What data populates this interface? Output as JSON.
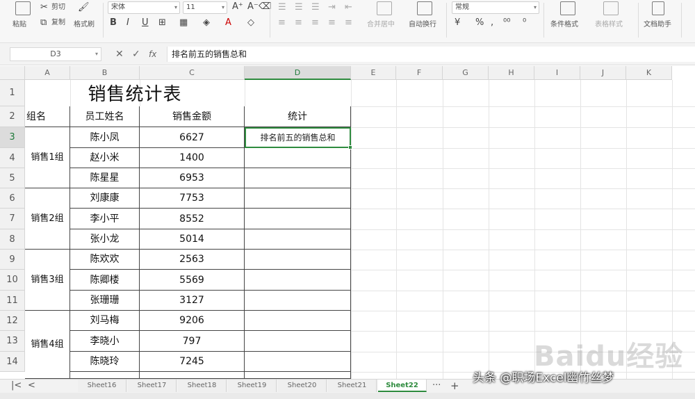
{
  "ribbon": {
    "clipboard": {
      "cut": "剪切",
      "paste": "粘贴",
      "copy": "复制",
      "format_painter": "格式刷"
    },
    "font_name": "宋体",
    "font_size": "11",
    "number_format": "常规",
    "buttons": {
      "wrap_text": "合并居中",
      "auto_wrap": "自动换行",
      "conditional_format": "条件格式",
      "table_style": "表格样式",
      "doc_assistant": "文档助手"
    }
  },
  "formula_bar": {
    "name_box": "D3",
    "fx": "fx",
    "content": "排名前五的销售总和"
  },
  "columns": [
    "A",
    "B",
    "C",
    "D",
    "E",
    "F",
    "G",
    "H",
    "I",
    "J",
    "K"
  ],
  "rows": [
    "1",
    "2",
    "3",
    "4",
    "5",
    "6",
    "7",
    "8",
    "9",
    "10",
    "11",
    "12",
    "13",
    "14"
  ],
  "sheet": {
    "title": "销售统计表",
    "headers": {
      "group": "组名",
      "name": "员工姓名",
      "amount": "销售金额",
      "stat": "统计"
    },
    "groups": [
      "销售1组",
      "销售2组",
      "销售3组",
      "销售4组"
    ],
    "names": [
      "陈小凤",
      "赵小米",
      "陈星星",
      "刘康康",
      "李小平",
      "张小龙",
      "陈欢欢",
      "陈卿楼",
      "张珊珊",
      "刘马梅",
      "李晓小",
      "陈晓玲"
    ],
    "amounts": [
      "6627",
      "1400",
      "6953",
      "7753",
      "8552",
      "5014",
      "2563",
      "5569",
      "3127",
      "9206",
      "797",
      "7245"
    ],
    "stat_label": "排名前五的销售总和"
  },
  "tabs": {
    "items": [
      "Sheet16",
      "Sheet17",
      "Sheet18",
      "Sheet19",
      "Sheet20",
      "Sheet21",
      "Sheet22"
    ],
    "active": "Sheet22",
    "more": "···",
    "add": "+"
  },
  "watermark": "Baidu经验",
  "credit": "头条 @职场Excel幽竹丝梦"
}
